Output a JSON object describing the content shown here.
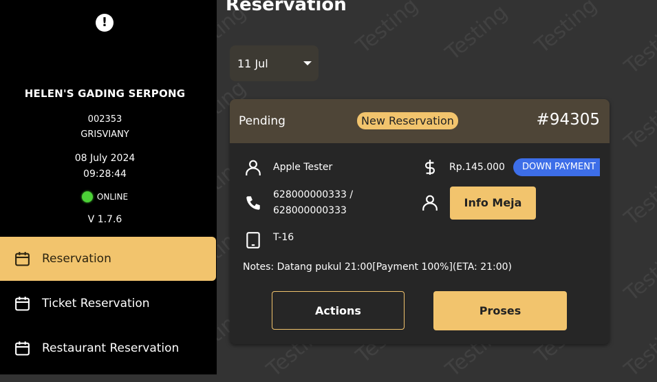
{
  "sidebar": {
    "store_name": "HELEN'S GADING SERPONG",
    "user_id": "002353",
    "user_name": "GRISVIANY",
    "date": "08 July 2024",
    "time": "09:28:44",
    "status": "ONLINE",
    "version": "V 1.7.6",
    "nav": [
      {
        "label": "Reservation",
        "icon": "calendar-icon",
        "active": true
      },
      {
        "label": "Ticket Reservation",
        "icon": "calendar-icon",
        "active": false
      },
      {
        "label": "Restaurant Reservation",
        "icon": "calendar-icon",
        "active": false
      }
    ]
  },
  "header": {
    "title": "Reservation"
  },
  "filter": {
    "date_value": "11 Jul"
  },
  "reservation": {
    "status": "Pending",
    "badge": "New Reservation",
    "number": "#94305",
    "customer_name": "Apple Tester",
    "phone_line1": "628000000333 /",
    "phone_line2": "628000000333",
    "table": "T-16",
    "amount": "Rp.145.000",
    "payment_type": "DOWN PAYMENT",
    "info_meja_label": "Info Meja",
    "notes": "Notes: Datang pukul 21:00[Payment 100%](ETA: 21:00)",
    "actions_label": "Actions",
    "proses_label": "Proses"
  },
  "watermark": "Testing",
  "colors": {
    "accent": "#f2c46d",
    "online": "#4cd137",
    "payment_badge": "#3d6ee8"
  }
}
